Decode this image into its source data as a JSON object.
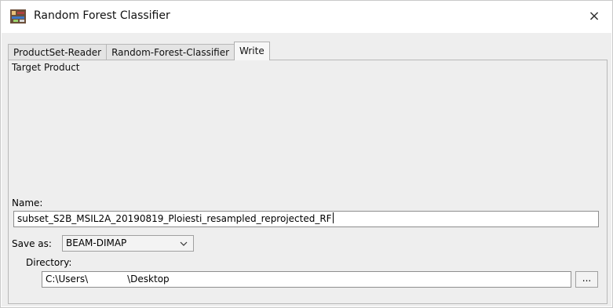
{
  "window": {
    "title": "Random Forest Classifier",
    "close_symbol": "×",
    "app_icon": "graph-builder-icon"
  },
  "tabs": [
    {
      "label": "ProductSet-Reader",
      "active": false
    },
    {
      "label": "Random-Forest-Classifier",
      "active": false
    },
    {
      "label": "Write",
      "active": true
    }
  ],
  "target_product": {
    "group_title": "Target Product",
    "name_label": "Name:",
    "name_value": "subset_S2B_MSIL2A_20190819_Ploiesti_resampled_reprojected_RF",
    "save_as_label": "Save as:",
    "save_as_value": "BEAM-DIMAP",
    "directory_label": "Directory:",
    "directory_value_prefix": "C:\\Users\\",
    "directory_value_suffix": "\\Desktop",
    "browse_label": "..."
  }
}
